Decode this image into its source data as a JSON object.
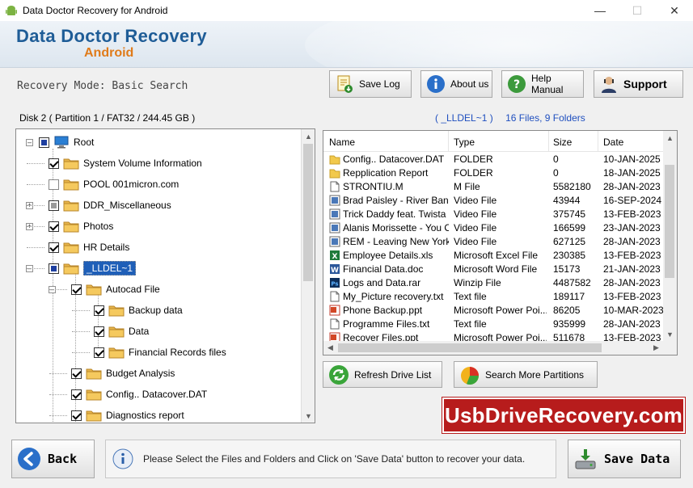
{
  "window": {
    "title": "Data Doctor Recovery for Android"
  },
  "banner": {
    "brand": "Data Doctor Recovery",
    "sub": "Android"
  },
  "toolbar": {
    "mode": "Recovery Mode: Basic Search",
    "save_log": "Save Log",
    "about": "About us",
    "help": "Help Manual",
    "support": "Support"
  },
  "disk": {
    "label": "Disk 2 ( Partition 1 / FAT32 / 244.45 GB )"
  },
  "path": {
    "folder": "( _LLDEL~1 )",
    "counts": "16 Files, 9 Folders"
  },
  "tree": {
    "root": "Root",
    "items": [
      "System Volume Information",
      "POOL 001micron.com",
      "DDR_Miscellaneous",
      "Photos",
      "HR Details",
      "_LLDEL~1",
      "Autocad File",
      "Backup data",
      "Data",
      "Financial Records files",
      "Budget Analysis",
      "Config.. Datacover.DAT",
      "Diagnostics report"
    ]
  },
  "files": {
    "columns": [
      "Name",
      "Type",
      "Size",
      "Date"
    ],
    "rows": [
      {
        "name": "Config.. Datacover.DAT",
        "type": "FOLDER",
        "size": "0",
        "date": "10-JAN-2025",
        "icon": "folder-icon"
      },
      {
        "name": "Repplication Report",
        "type": "FOLDER",
        "size": "0",
        "date": "18-JAN-2025",
        "icon": "folder-icon"
      },
      {
        "name": "STRONTIU.M",
        "type": "M File",
        "size": "5582180",
        "date": "28-JAN-2023",
        "icon": "file-icon"
      },
      {
        "name": "Brad Paisley - River Bank....",
        "type": "Video File",
        "size": "43944",
        "date": "16-SEP-2024",
        "icon": "video-icon"
      },
      {
        "name": "Trick Daddy feat. Twista ....",
        "type": "Video File",
        "size": "375745",
        "date": "13-FEB-2023",
        "icon": "video-icon"
      },
      {
        "name": "Alanis Morissette - You Ou...",
        "type": "Video File",
        "size": "166599",
        "date": "23-JAN-2023",
        "icon": "video-icon"
      },
      {
        "name": "REM - Leaving New York....",
        "type": "Video File",
        "size": "627125",
        "date": "28-JAN-2023",
        "icon": "video-icon"
      },
      {
        "name": "Employee Details.xls",
        "type": "Microsoft Excel File",
        "size": "230385",
        "date": "13-FEB-2023",
        "icon": "excel-icon"
      },
      {
        "name": "Financial Data.doc",
        "type": "Microsoft Word File",
        "size": "15173",
        "date": "21-JAN-2023",
        "icon": "word-icon"
      },
      {
        "name": "Logs and Data.rar",
        "type": "Winzip File",
        "size": "4487582",
        "date": "28-JAN-2023",
        "icon": "photoshop-icon"
      },
      {
        "name": "My_Picture recovery.txt",
        "type": "Text file",
        "size": "189117",
        "date": "13-FEB-2023",
        "icon": "file-icon"
      },
      {
        "name": "Phone Backup.ppt",
        "type": "Microsoft Power Poi...",
        "size": "86205",
        "date": "10-MAR-2023",
        "icon": "ppt-icon"
      },
      {
        "name": "Programme Files.txt",
        "type": "Text file",
        "size": "935999",
        "date": "28-JAN-2023",
        "icon": "file-icon"
      },
      {
        "name": "Recover Files.ppt",
        "type": "Microsoft Power Poi...",
        "size": "511678",
        "date": "13-FEB-2023",
        "icon": "ppt-icon"
      }
    ]
  },
  "actions": {
    "refresh": "Refresh Drive List",
    "search_more": "Search More Partitions"
  },
  "promo": "UsbDriveRecovery.com",
  "bottom": {
    "back": "Back",
    "message": "Please Select the Files and Folders and Click on 'Save Data' button to recover your data.",
    "save": "Save Data"
  }
}
